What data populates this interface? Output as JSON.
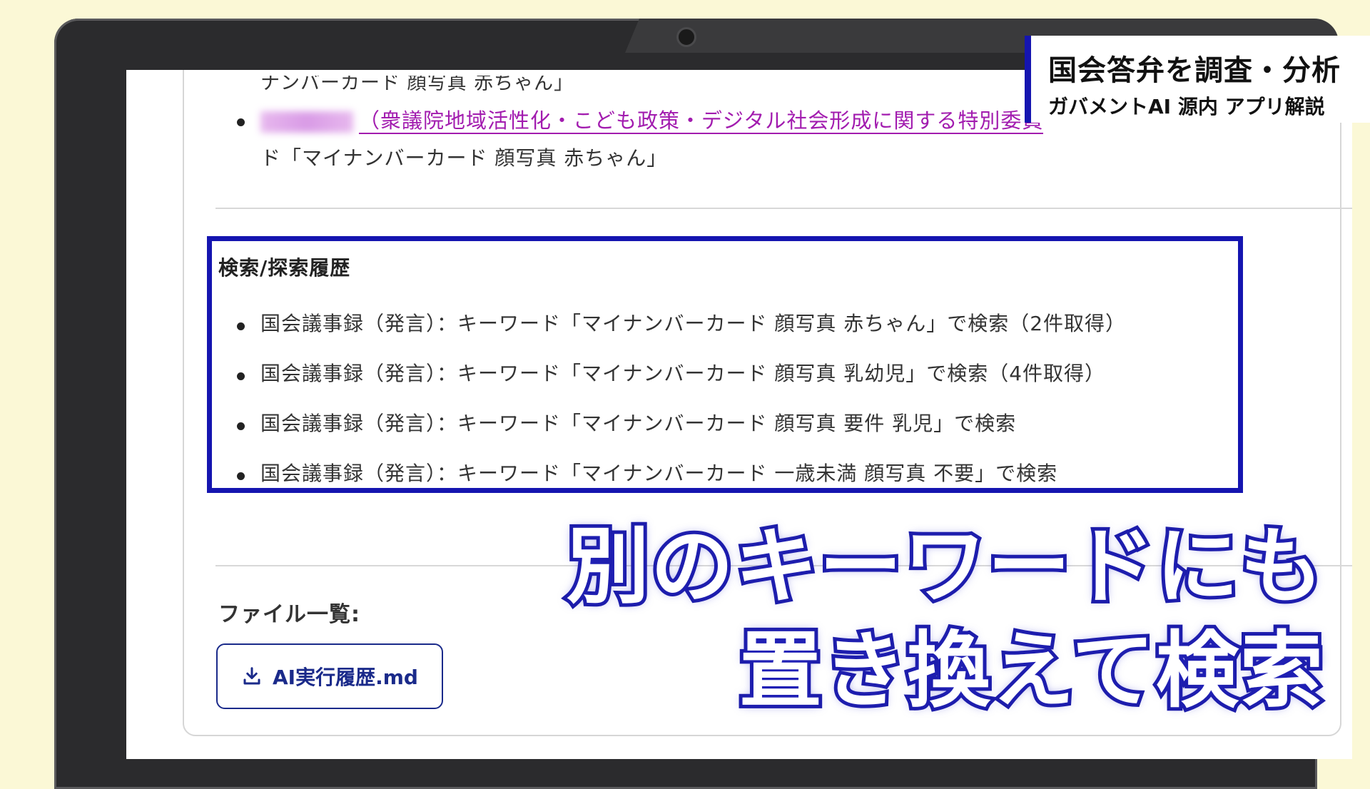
{
  "content": {
    "prev_line_clipped": "ナンバーカード 顔写真 赤ちゃん」",
    "link_text": "（衆議院地域活性化・こども政策・デジタル社会形成に関する特別委員",
    "link_continuation": "ド「マイナンバーカード 顔写真 赤ちゃん」"
  },
  "history": {
    "title": "検索/探索履歴",
    "items": [
      "国会議事録（発言）：キーワード「マイナンバーカード 顔写真 赤ちゃん」で検索（2件取得）",
      "国会議事録（発言）：キーワード「マイナンバーカード 顔写真 乳幼児」で検索（4件取得）",
      "国会議事録（発言）：キーワード「マイナンバーカード 顔写真 要件 乳児」で検索",
      "国会議事録（発言）：キーワード「マイナンバーカード 一歳未満 顔写真 不要」で検索"
    ]
  },
  "files": {
    "label": "ファイル一覧:",
    "download_label": "AI実行履歴.md",
    "icon": "download-icon"
  },
  "badge": {
    "title": "国会答弁を調査・分析",
    "subtitle": "ガバメントAI 源内 アプリ解説"
  },
  "caption": {
    "line1": "別のキーワードにも",
    "line2": "置き換えて検索"
  },
  "colors": {
    "accent_blue": "#1515b0",
    "link_purple": "#a21caf",
    "background": "#fbf8d6"
  }
}
